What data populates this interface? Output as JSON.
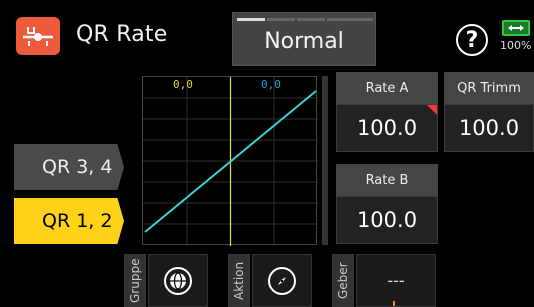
{
  "header": {
    "title": "QR Rate",
    "logo_icon": "aileron-servo-icon",
    "mode": {
      "label": "Normal",
      "segments": 5,
      "active_segment": 0
    },
    "help_symbol": "?",
    "battery": {
      "percent": "100%",
      "color": "#2fc843"
    }
  },
  "graph": {
    "left_value": "0,0",
    "right_value": "0,0",
    "left_value_color": "#d7d33a",
    "right_value_color": "#2aa0d8",
    "curve_color": "#39d0d8",
    "cursor_color": "#e6e33a",
    "curve": {
      "x": [
        -100,
        100
      ],
      "y": [
        -100,
        100
      ]
    },
    "cursor_x": 0
  },
  "sidebar": {
    "items": [
      {
        "label": "QR 3, 4",
        "active": false
      },
      {
        "label": "QR 1, 2",
        "active": true
      }
    ]
  },
  "values": {
    "rate_a": {
      "label": "Rate A",
      "value": "100.0"
    },
    "qr_trimm": {
      "label": "QR Trimm",
      "value": "100.0"
    },
    "rate_b": {
      "label": "Rate B",
      "value": "100.0"
    }
  },
  "bottom": {
    "gruppe_label": "Gruppe",
    "gruppe_icon": "globe-icon",
    "aktion_label": "Aktion",
    "aktion_icon": "compass-icon",
    "geber_label": "Geber",
    "geber_value": "---"
  },
  "colors": {
    "accent_orange": "#ef5a3a",
    "accent_yellow": "#ffd21a"
  }
}
